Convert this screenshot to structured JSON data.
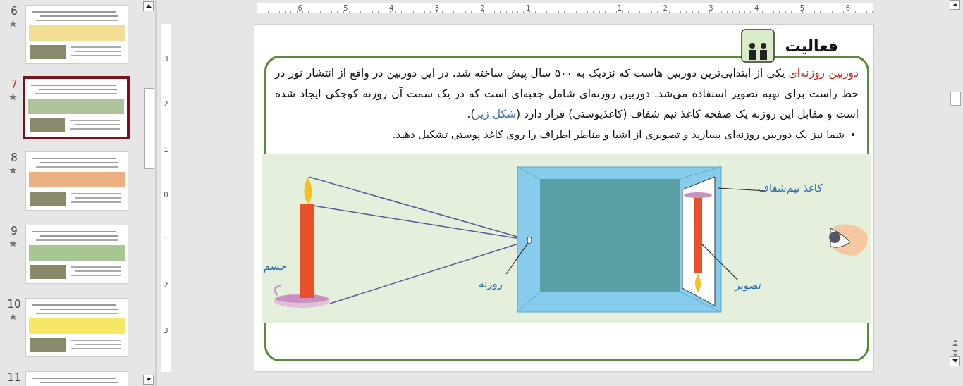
{
  "slides": [
    {
      "number": "6",
      "selected": false
    },
    {
      "number": "7",
      "selected": true
    },
    {
      "number": "8",
      "selected": false
    },
    {
      "number": "9",
      "selected": false
    },
    {
      "number": "10",
      "selected": false
    },
    {
      "number": "11",
      "selected": false
    }
  ],
  "ruler_horizontal": [
    "6",
    "5",
    "4",
    "3",
    "2",
    "1",
    "1",
    "2",
    "3",
    "4",
    "5",
    "6"
  ],
  "ruler_vertical": [
    "3",
    "2",
    "1",
    "0",
    "1",
    "2",
    "3"
  ],
  "slide": {
    "heading": "فعالیت",
    "paragraph": [
      {
        "kind": "term",
        "text": "دوربین روزنه‌ای"
      },
      {
        "kind": "plain",
        "text": " یکی از ابتدایی‌ترین دوربین هاست که نزدیک به ۵۰۰ سال پیش ساخته شد. در این دوربین در واقع از انتشار نور در خط راست برای تهیه تصویر استفاده می‌شد. دوربین روزنه‌ای شامل جعبه‌ای است که در یک سمت آن روزنه کوچکی ایجاد شده است و مقابل این روزنه یک صفحه کاغذ نیم شفاف (کاغذپوستی) قرار دارد ("
      },
      {
        "kind": "link",
        "text": "شکل زیر"
      },
      {
        "kind": "plain",
        "text": ")."
      }
    ],
    "bullets": [
      "شما نیز یک دوربین روزنه‌ای بسازید و تصویری از اشیا و مناظر اطراف را روی کاغذ پوستی تشکیل دهید."
    ],
    "figure_labels": {
      "paper": "کاغذ نیم‌شفاف",
      "image": "تصویر",
      "pinhole": "روزنه",
      "object": "جسم"
    }
  }
}
